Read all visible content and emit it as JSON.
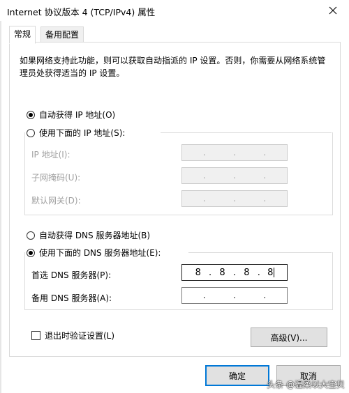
{
  "window": {
    "title": "Internet 协议版本 4 (TCP/IPv4) 属性"
  },
  "tabs": [
    {
      "label": "常规"
    },
    {
      "label": "备用配置"
    }
  ],
  "description": "如果网络支持此功能，则可以获取自动指派的 IP 设置。否则，你需要从网络系统管理员处获得适当的 IP 设置。",
  "ip_section": {
    "auto_label": "自动获得 IP 地址(O)",
    "manual_label": "使用下面的 IP 地址(S):",
    "auto_selected": true,
    "fields": [
      {
        "label": "IP 地址(I):",
        "value": ".      .      ."
      },
      {
        "label": "子网掩码(U):",
        "value": ".      .      ."
      },
      {
        "label": "默认网关(D):",
        "value": ".      .      ."
      }
    ]
  },
  "dns_section": {
    "auto_label": "自动获得 DNS 服务器地址(B)",
    "manual_label": "使用下面的 DNS 服务器地址(E):",
    "manual_selected": true,
    "preferred": {
      "label": "首选 DNS 服务器(P):",
      "octets": [
        "8",
        "8",
        "8",
        "8"
      ]
    },
    "alternate": {
      "label": "备用 DNS 服务器(A):",
      "octets": [
        "",
        "",
        "",
        ""
      ]
    }
  },
  "validate_label": "退出时验证设置(L)",
  "advanced_label": "高级(V)...",
  "ok_label": "确定",
  "cancel_label": "取消",
  "watermark": "头条 @温柔以大宝贝",
  "colors": {
    "accent": "#0078d7",
    "disabled_text": "#a0a0a0",
    "disabled_box": "#f0f0f0"
  }
}
